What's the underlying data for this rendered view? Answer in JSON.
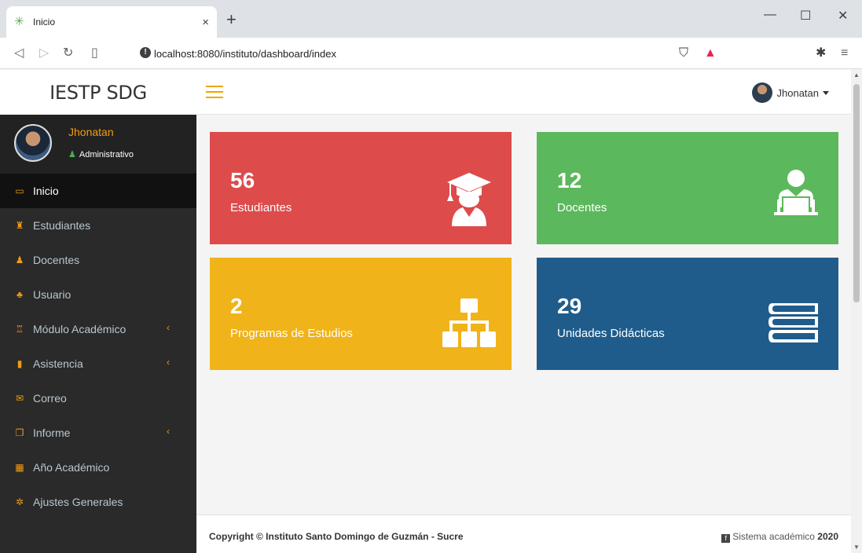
{
  "browser": {
    "tab_title": "Inicio",
    "tab_close": "×",
    "new_tab": "+",
    "url": "localhost:8080/instituto/dashboard/index",
    "window_controls": {
      "minimize": "—",
      "maximize": "☐",
      "close": "✕"
    }
  },
  "header": {
    "brand": "IESTP SDG",
    "user_name": "Jhonatan"
  },
  "sidebar": {
    "profile_name": "Jhonatan",
    "profile_role": "Administrativo",
    "items": [
      {
        "label": "Inicio",
        "icon": "laptop-icon",
        "glyph": "▭",
        "active": true,
        "has_submenu": false
      },
      {
        "label": "Estudiantes",
        "icon": "student-icon",
        "glyph": "♜",
        "active": false,
        "has_submenu": false
      },
      {
        "label": "Docentes",
        "icon": "teacher-icon",
        "glyph": "♟",
        "active": false,
        "has_submenu": false
      },
      {
        "label": "Usuario",
        "icon": "users-icon",
        "glyph": "♣",
        "active": false,
        "has_submenu": false
      },
      {
        "label": "Módulo Académico",
        "icon": "bank-icon",
        "glyph": "♖",
        "active": false,
        "has_submenu": true
      },
      {
        "label": "Asistencia",
        "icon": "clipboard-icon",
        "glyph": "▮",
        "active": false,
        "has_submenu": true
      },
      {
        "label": "Correo",
        "icon": "envelope-icon",
        "glyph": "✉",
        "active": false,
        "has_submenu": false
      },
      {
        "label": "Informe",
        "icon": "copy-icon",
        "glyph": "❐",
        "active": false,
        "has_submenu": true
      },
      {
        "label": "Año Académico",
        "icon": "calendar-icon",
        "glyph": "▦",
        "active": false,
        "has_submenu": false
      },
      {
        "label": "Ajustes Generales",
        "icon": "cogs-icon",
        "glyph": "✲",
        "active": false,
        "has_submenu": false
      }
    ],
    "submenu_glyph": "‹"
  },
  "stats": [
    {
      "value": "56",
      "label": "Estudiantes",
      "color": "#dd4b4b",
      "icon": "graduate-icon"
    },
    {
      "value": "12",
      "label": "Docentes",
      "color": "#5cb85c",
      "icon": "teacher-laptop-icon"
    },
    {
      "value": "2",
      "label": "Programas de Estudios",
      "color": "#f0b31a",
      "icon": "sitemap-icon"
    },
    {
      "value": "29",
      "label": "Unidades Didácticas",
      "color": "#1f5c8b",
      "icon": "books-icon"
    }
  ],
  "footer": {
    "copyright": "Copyright © Instituto Santo Domingo de Guzmán - Sucre",
    "system_text": "Sistema académico",
    "year": "2020"
  },
  "colors": {
    "accent": "#f39c12",
    "sidebar_bg": "#2a2a2a"
  }
}
